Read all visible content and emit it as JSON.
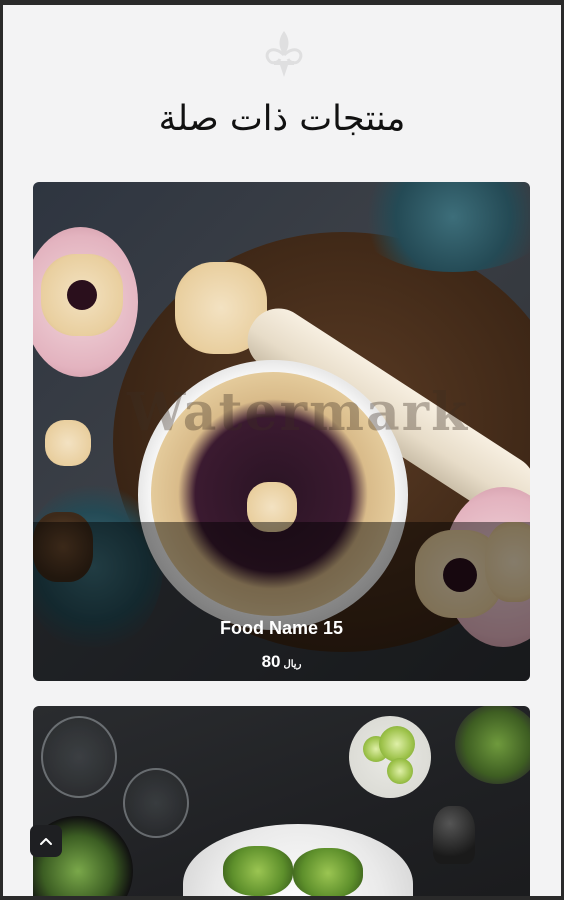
{
  "section": {
    "title": "منتجات ذات صلة"
  },
  "products": [
    {
      "name": "Food Name 15",
      "price": "80",
      "currency": "ريال",
      "watermark": "Watermark"
    },
    {
      "name": "",
      "price": ""
    }
  ],
  "icons": {
    "logo": "fleur-de-lis-icon",
    "scroll_top": "chevron-up-icon"
  },
  "colors": {
    "page_bg": "#f3f3f4",
    "text": "#111111",
    "button_bg": "#1e1f22"
  }
}
